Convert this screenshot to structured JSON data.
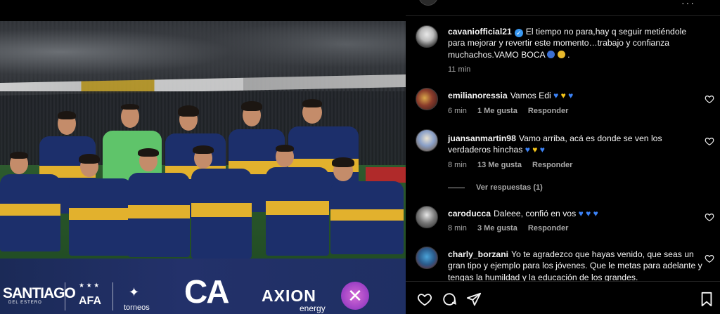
{
  "post": {
    "photo_alt": "",
    "banner": {
      "santiago": "SANTIAGO",
      "santiago_sub": "DEL ESTERO",
      "afa": "AFA",
      "afa_stars": "★ ★ ★",
      "torneos": "torneos",
      "ca": "CA",
      "axion": "AXION",
      "energy": "energy",
      "x": "✕"
    }
  },
  "caption": {
    "username": "cavaniofficial21",
    "text": "El tiempo no para,hay q seguir metiéndole para mejorar y revertir este momento…trabajo y confianza muchachos.VAMO BOCA",
    "time": "11 min"
  },
  "comments": [
    {
      "username": "emilianoressia",
      "text": "Vamos Edi",
      "time": "6 min",
      "likes": "1 Me gusta",
      "reply": "Responder"
    },
    {
      "username": "juansanmartin98",
      "text": "Vamo arriba, acá es donde se ven los verdaderos hinchas",
      "time": "8 min",
      "likes": "13 Me gusta",
      "reply": "Responder",
      "replies_toggle": "Ver respuestas (1)"
    },
    {
      "username": "caroducca",
      "text": "Daleee, confió en vos",
      "time": "8 min",
      "likes": "3 Me gusta",
      "reply": "Responder"
    },
    {
      "username": "charly_borzani",
      "text": "Yo te agradezco que hayas venido, que seas un gran tipo y ejemplo para los jóvenes. Que le metas para adelante y tengas la humildad y la educación de los grandes."
    }
  ],
  "icons": {
    "like": "heart-outline-icon",
    "comment": "comment-bubble-icon",
    "share": "paper-plane-icon",
    "save": "bookmark-icon",
    "verified": "verified-badge-icon",
    "more": "more-dots-icon"
  },
  "colors": {
    "background": "#000000",
    "text": "#f5f5f5",
    "secondary_text": "#a8a8a8",
    "verified": "#3897f0",
    "boca_blue": "#1c2f6b",
    "boca_gold": "#e2b12d"
  }
}
